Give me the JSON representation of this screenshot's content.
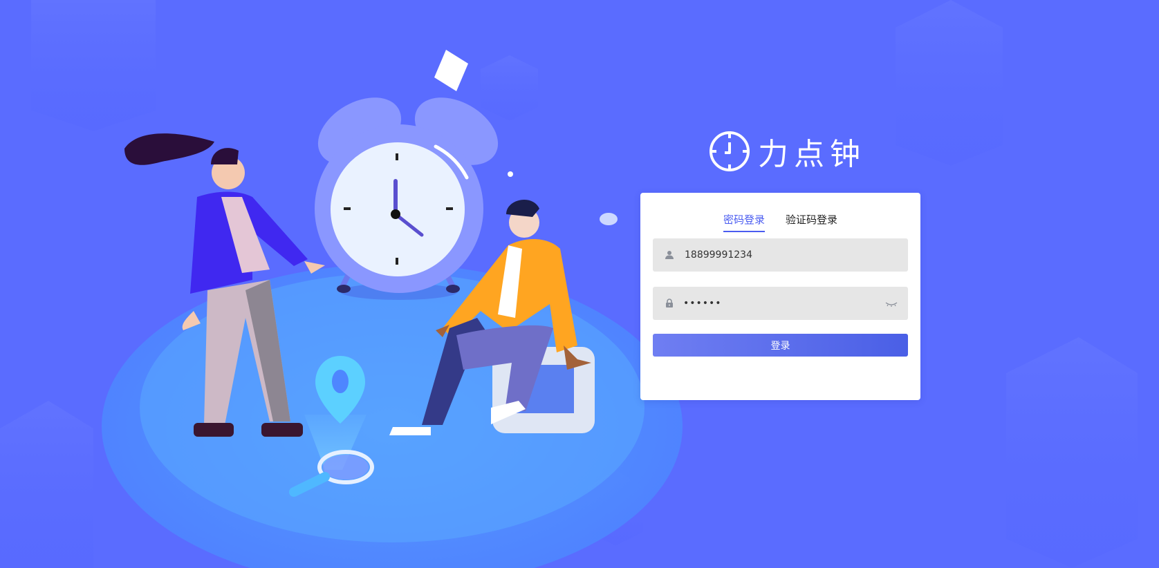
{
  "brand": {
    "name": "力点钟"
  },
  "login": {
    "tabs": [
      {
        "label": "密码登录",
        "active": true
      },
      {
        "label": "验证码登录",
        "active": false
      }
    ],
    "username": {
      "value": "18899991234"
    },
    "password": {
      "value": "••••••"
    },
    "submit_label": "登录"
  },
  "colors": {
    "background": "#5a6cff",
    "accent": "#4a5cf0",
    "field_bg": "#e6e6e6"
  }
}
